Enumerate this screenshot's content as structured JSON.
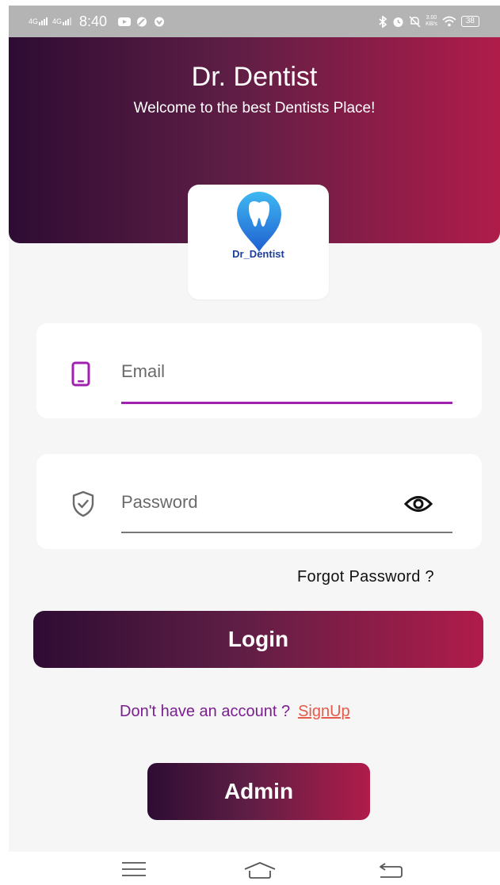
{
  "status_bar": {
    "network_1": "4G",
    "network_2": "4G",
    "time": "8:40",
    "speed_value": "3.00",
    "speed_unit": "KB/s",
    "battery": "38"
  },
  "header": {
    "title": "Dr. Dentist",
    "subtitle": "Welcome to the best Dentists Place!"
  },
  "logo": {
    "text": "Dr_Dentist"
  },
  "form": {
    "email_placeholder": "Email",
    "password_placeholder": "Password",
    "forgot_label": "Forgot Password ?",
    "login_label": "Login",
    "signup_prompt": "Don't have an account ?",
    "signup_label": "SignUp",
    "admin_label": "Admin"
  },
  "colors": {
    "gradient_start": "#2e0c33",
    "gradient_end": "#b01c4a",
    "accent_purple": "#a020b0",
    "signup_link": "#e55a4a",
    "logo_blue": "#1d3f9b"
  },
  "icons": [
    "phone-icon",
    "shield-check-icon",
    "eye-icon",
    "tooth-logo-icon",
    "menu-icon",
    "home-icon",
    "back-icon"
  ]
}
